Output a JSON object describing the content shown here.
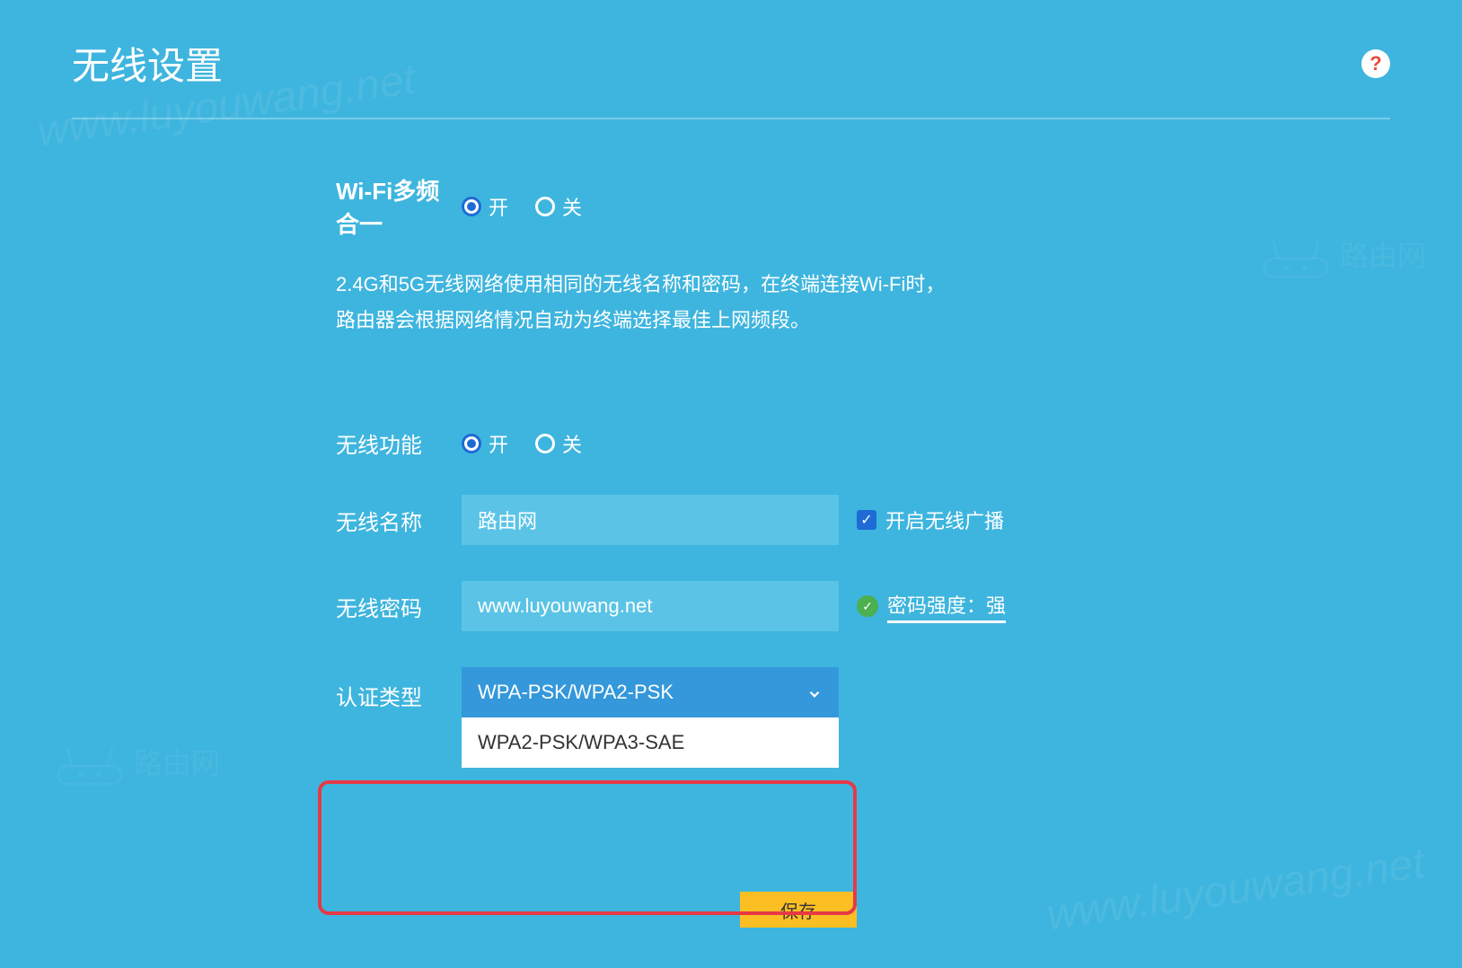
{
  "page": {
    "title": "无线设置"
  },
  "help": {
    "symbol": "?"
  },
  "multiband": {
    "label": "Wi-Fi多频合一",
    "option_on": "开",
    "option_off": "关",
    "selected": "on",
    "description_line1": "2.4G和5G无线网络使用相同的无线名称和密码，在终端连接Wi-Fi时，",
    "description_line2": "路由器会根据网络情况自动为终端选择最佳上网频段。"
  },
  "wireless_function": {
    "label": "无线功能",
    "option_on": "开",
    "option_off": "关",
    "selected": "on"
  },
  "ssid": {
    "label": "无线名称",
    "value": "路由网",
    "broadcast_label": "开启无线广播",
    "broadcast_checked": true
  },
  "password": {
    "label": "无线密码",
    "value": "www.luyouwang.net",
    "strength_label": "密码强度：强"
  },
  "auth": {
    "label": "认证类型",
    "selected": "WPA-PSK/WPA2-PSK",
    "options": [
      "WPA-PSK/WPA2-PSK",
      "WPA2-PSK/WPA3-SAE"
    ]
  },
  "save": {
    "label": "保存"
  },
  "watermarks": {
    "url": "www.luyouwang.net",
    "brand": "路由网"
  }
}
